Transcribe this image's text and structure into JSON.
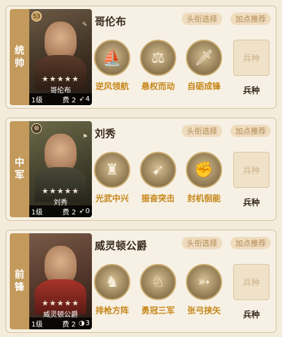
{
  "cards": [
    {
      "role": [
        "统",
        "帅"
      ],
      "badge": "53",
      "name": "哥伦布",
      "portrait_name": "哥伦布",
      "stars": "★★★★★",
      "level": "1级",
      "cost_label": "费",
      "cost": "2",
      "count": "4",
      "count_icon": "arrows-icon",
      "buttons": [
        "头衔选择",
        "加点推荐"
      ],
      "skills": [
        {
          "name": "逆风领航",
          "icon": "ship-icon"
        },
        {
          "name": "悬权而动",
          "icon": "scales-icon"
        },
        {
          "name": "自砺成锋",
          "icon": "blade-icon"
        }
      ],
      "troop_box": "兵种",
      "troop_label": "兵种"
    },
    {
      "role": [
        "中",
        "军"
      ],
      "badge": "⊗",
      "name": "刘秀",
      "portrait_name": "刘秀",
      "stars": "★★★★★",
      "level": "1级",
      "cost_label": "费",
      "cost": "2",
      "count": "0",
      "count_icon": "arrows-icon",
      "buttons": [
        "头衔选择",
        "加点推荐"
      ],
      "skills": [
        {
          "name": "光武中兴",
          "icon": "statue-icon"
        },
        {
          "name": "振奋突击",
          "icon": "spear-icon"
        },
        {
          "name": "封机徊能",
          "icon": "gauntlet-icon"
        }
      ],
      "troop_box": "兵种",
      "troop_label": "兵种"
    },
    {
      "role": [
        "前",
        "锋"
      ],
      "badge": "",
      "name": "威灵顿公爵",
      "portrait_name": "威灵顿公爵",
      "stars": "★★★★★",
      "level": "1级",
      "cost_label": "费",
      "cost": "2",
      "count": "3",
      "count_icon": "half-circle-icon",
      "buttons": [
        "头衔选择",
        "加点推荐"
      ],
      "skills": [
        {
          "name": "排枪方阵",
          "icon": "soldier-icon"
        },
        {
          "name": "勇冠三军",
          "icon": "cavalry-icon"
        },
        {
          "name": "张弓挟矢",
          "icon": "archer-icon"
        }
      ],
      "troop_box": "兵种",
      "troop_label": "兵种"
    }
  ]
}
